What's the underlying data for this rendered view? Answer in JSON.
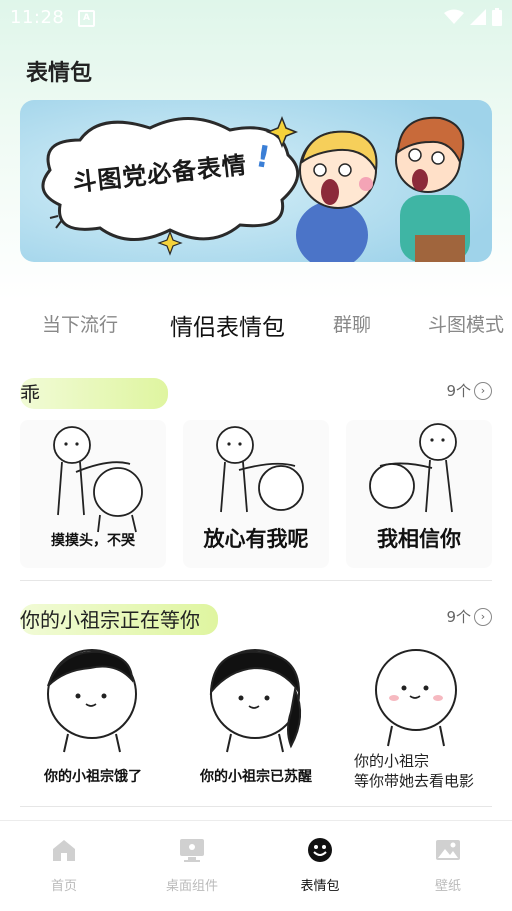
{
  "status": {
    "time": "11:28",
    "app_badge": "A"
  },
  "page": {
    "title": "表情包"
  },
  "banner": {
    "text": "斗图党必备表情"
  },
  "tabs": [
    {
      "label": "当下流行"
    },
    {
      "label": "情侣表情包"
    },
    {
      "label": "群聊"
    },
    {
      "label": "斗图模式"
    }
  ],
  "active_tab": "情侣表情包",
  "sections": [
    {
      "title": "乖",
      "count": "9个",
      "stickers": [
        {
          "caption": "摸摸头，不哭"
        },
        {
          "caption": "放心有我呢"
        },
        {
          "caption": "我相信你"
        }
      ]
    },
    {
      "title": "你的小祖宗正在等你",
      "count": "9个",
      "stickers": [
        {
          "caption": "你的小祖宗饿了"
        },
        {
          "caption": "你的小祖宗已苏醒"
        },
        {
          "caption_line1": "你的小祖宗",
          "caption_line2": "等你带她去看电影"
        }
      ]
    }
  ],
  "bottom_nav": [
    {
      "label": "首页",
      "icon": "home-icon"
    },
    {
      "label": "桌面组件",
      "icon": "desktop-widget-icon"
    },
    {
      "label": "表情包",
      "icon": "smiley-icon"
    },
    {
      "label": "壁纸",
      "icon": "wallpaper-icon"
    }
  ],
  "colors": {
    "accent_highlight": "#dff5a0",
    "banner_bg": "#bfe3f2",
    "active_text": "#111111",
    "inactive_text": "#bbbbbb"
  }
}
